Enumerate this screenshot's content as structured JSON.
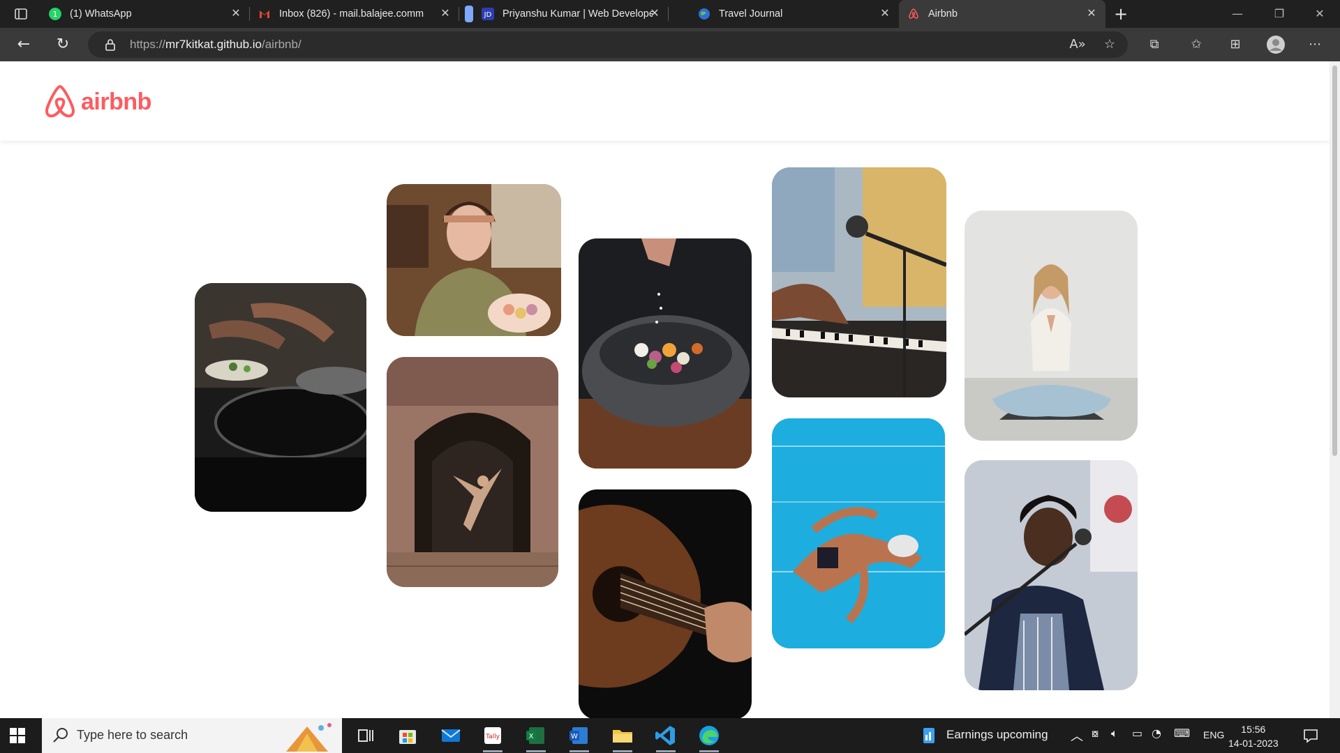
{
  "browser": {
    "tabs": [
      {
        "label": "(1) WhatsApp",
        "favicon": "whatsapp-icon"
      },
      {
        "label": "Inbox (826) - mail.balajee.comm",
        "favicon": "gmail-icon"
      },
      {
        "label": "Priyanshu Kumar | Web Develope",
        "favicon": "jd-icon"
      },
      {
        "label": "Travel Journal",
        "favicon": "globe-icon"
      },
      {
        "label": "Airbnb",
        "favicon": "airbnb-icon"
      }
    ],
    "url_prefix": "https://",
    "url_host": "mr7kitkat.github.io",
    "url_path": "/airbnb/"
  },
  "page": {
    "logo_text": "airbnb",
    "brand_color": "#FF5A5F",
    "photos": [
      {
        "name": "photo-cooking-pan"
      },
      {
        "name": "photo-woman-macarons"
      },
      {
        "name": "photo-dancer-doorway"
      },
      {
        "name": "photo-salad-bowl"
      },
      {
        "name": "photo-guitar"
      },
      {
        "name": "photo-piano-microphone"
      },
      {
        "name": "photo-swimmer-pool"
      },
      {
        "name": "photo-yoga-woman"
      },
      {
        "name": "photo-singer-microphone"
      }
    ]
  },
  "taskbar": {
    "search_placeholder": "Type here to search",
    "news_label": "Earnings upcoming",
    "language": "ENG",
    "time": "15:56",
    "date": "14-01-2023"
  }
}
